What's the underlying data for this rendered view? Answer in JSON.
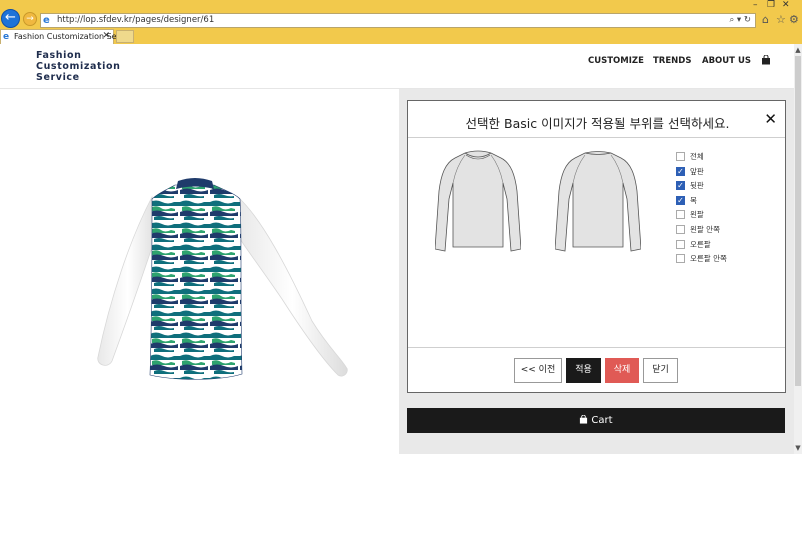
{
  "browser": {
    "url": "http://lop.sfdev.kr/pages/designer/61",
    "url_tools": "⌕ ▾ ↻",
    "tab_title": "Fashion Customization Ser...",
    "back_glyph": "←",
    "forward_glyph": "→"
  },
  "site": {
    "logo_lines": [
      "Fashion",
      "Customization",
      "Service"
    ],
    "nav": [
      "CUSTOMIZE",
      "TRENDS",
      "ABOUT US"
    ]
  },
  "modal": {
    "title": "선택한 Basic 이미지가 적용될 부위를 선택하세요.",
    "close_glyph": "✕",
    "parts": [
      {
        "label": "전체",
        "checked": false
      },
      {
        "label": "앞판",
        "checked": true
      },
      {
        "label": "뒷판",
        "checked": true
      },
      {
        "label": "목",
        "checked": true
      },
      {
        "label": "왼팔",
        "checked": false
      },
      {
        "label": "왼팔 안쪽",
        "checked": false
      },
      {
        "label": "오른팔",
        "checked": false
      },
      {
        "label": "오른팔 안쪽",
        "checked": false
      }
    ],
    "buttons": {
      "prev": "<< 이전",
      "apply": "적용",
      "delete": "삭제",
      "close": "닫기"
    }
  },
  "cart": {
    "label": "Cart"
  },
  "colors": {
    "chrome": "#f2c94c",
    "accent_delete": "#e05a55",
    "dark_button": "#1a1a1a",
    "checkbox": "#2d5fb5",
    "pattern_teal": "#0f6f7c",
    "pattern_green": "#2ea36f",
    "pattern_navy": "#1f3b6b"
  }
}
